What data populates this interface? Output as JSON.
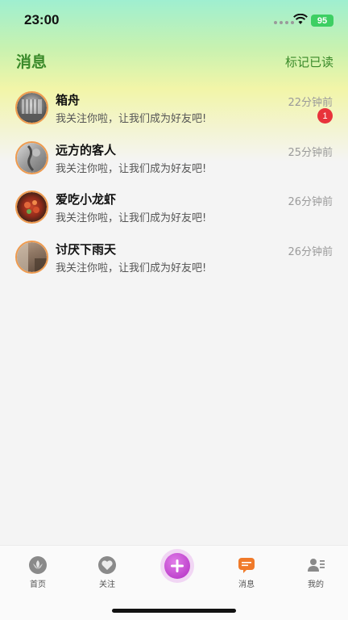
{
  "status_bar": {
    "time": "23:00",
    "battery": "95"
  },
  "header": {
    "title": "消息",
    "mark_read": "标记已读"
  },
  "messages": [
    {
      "name": "箱舟",
      "text": "我关注你啦，让我们成为好友吧!",
      "time": "22分钟前",
      "badge": "1"
    },
    {
      "name": "远方的客人",
      "text": "我关注你啦，让我们成为好友吧!",
      "time": "25分钟前",
      "badge": ""
    },
    {
      "name": "爱吃小龙虾",
      "text": "我关注你啦，让我们成为好友吧!",
      "time": "26分钟前",
      "badge": ""
    },
    {
      "name": "讨厌下雨天",
      "text": "我关注你啦，让我们成为好友吧!",
      "time": "26分钟前",
      "badge": ""
    }
  ],
  "tabbar": {
    "home": "首页",
    "follow": "关注",
    "messages": "消息",
    "mine": "我的"
  },
  "colors": {
    "accent": "#3a8a2a",
    "badge": "#e8333b",
    "avatar_ring": "#ee9a4e",
    "plus": "#b12dc2"
  }
}
